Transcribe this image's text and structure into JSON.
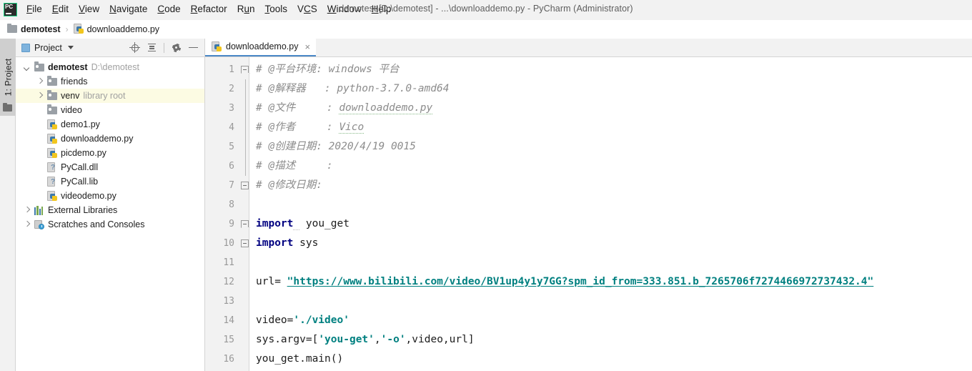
{
  "window": {
    "title": "demotest [D:\\demotest] - ...\\downloaddemo.py - PyCharm (Administrator)",
    "logo_text": "PC"
  },
  "menubar": {
    "items": [
      {
        "label": "File",
        "mnemonic": "F"
      },
      {
        "label": "Edit",
        "mnemonic": "E"
      },
      {
        "label": "View",
        "mnemonic": "V"
      },
      {
        "label": "Navigate",
        "mnemonic": "N"
      },
      {
        "label": "Code",
        "mnemonic": "C"
      },
      {
        "label": "Refactor",
        "mnemonic": "R"
      },
      {
        "label": "Run",
        "mnemonic": "u"
      },
      {
        "label": "Tools",
        "mnemonic": "T"
      },
      {
        "label": "VCS",
        "mnemonic": "C"
      },
      {
        "label": "Window",
        "mnemonic": "W"
      },
      {
        "label": "Help",
        "mnemonic": "H"
      }
    ]
  },
  "breadcrumb": {
    "project": "demotest",
    "separator": "›",
    "file": "downloaddemo.py"
  },
  "left_strip": {
    "tool_tab": "1: Project",
    "tool_tab_icon": "folder-icon"
  },
  "project_panel": {
    "title": "Project",
    "tools": [
      {
        "name": "locate-icon",
        "tooltip": "Select Opened File"
      },
      {
        "name": "collapse-all-icon",
        "tooltip": "Collapse All"
      },
      {
        "name": "gear-icon",
        "tooltip": "Settings"
      },
      {
        "name": "minimize-icon",
        "tooltip": "Hide"
      }
    ],
    "tree": [
      {
        "label": "demotest",
        "sub": "D:\\demotest",
        "icon": "folder-icon",
        "arrow": "down",
        "indent": 0,
        "bold": true,
        "highlight": false
      },
      {
        "label": "friends",
        "sub": "",
        "icon": "folder-icon",
        "arrow": "right",
        "indent": 1,
        "bold": false,
        "highlight": false
      },
      {
        "label": "venv",
        "sub": "library root",
        "icon": "folder-icon",
        "arrow": "right",
        "indent": 1,
        "bold": false,
        "highlight": true
      },
      {
        "label": "video",
        "sub": "",
        "icon": "folder-icon",
        "arrow": "none",
        "indent": 1,
        "bold": false,
        "highlight": false
      },
      {
        "label": "demo1.py",
        "sub": "",
        "icon": "python-file-icon",
        "arrow": "none",
        "indent": 1,
        "bold": false,
        "highlight": false
      },
      {
        "label": "downloaddemo.py",
        "sub": "",
        "icon": "python-file-icon",
        "arrow": "none",
        "indent": 1,
        "bold": false,
        "highlight": false
      },
      {
        "label": "picdemo.py",
        "sub": "",
        "icon": "python-file-icon",
        "arrow": "none",
        "indent": 1,
        "bold": false,
        "highlight": false
      },
      {
        "label": "PyCall.dll",
        "sub": "",
        "icon": "unknown-file-icon",
        "arrow": "none",
        "indent": 1,
        "bold": false,
        "highlight": false
      },
      {
        "label": "PyCall.lib",
        "sub": "",
        "icon": "unknown-file-icon",
        "arrow": "none",
        "indent": 1,
        "bold": false,
        "highlight": false
      },
      {
        "label": "videodemo.py",
        "sub": "",
        "icon": "python-file-icon",
        "arrow": "none",
        "indent": 1,
        "bold": false,
        "highlight": false
      },
      {
        "label": "External Libraries",
        "sub": "",
        "icon": "libraries-icon",
        "arrow": "right",
        "indent": 0,
        "bold": false,
        "highlight": false
      },
      {
        "label": "Scratches and Consoles",
        "sub": "",
        "icon": "scratches-icon",
        "arrow": "right",
        "indent": 0,
        "bold": false,
        "highlight": false
      }
    ]
  },
  "editor": {
    "tab": {
      "label": "downloaddemo.py",
      "icon": "python-file-icon",
      "close": "×"
    },
    "line_numbers": [
      "1",
      "2",
      "3",
      "4",
      "5",
      "6",
      "7",
      "8",
      "9",
      "10",
      "11",
      "12",
      "13",
      "14",
      "15",
      "16"
    ],
    "lines": [
      {
        "n": 1,
        "fold": "start",
        "segments": [
          {
            "t": "# @平台环境: windows 平台",
            "c": "cmt"
          }
        ]
      },
      {
        "n": 2,
        "fold": "body",
        "segments": [
          {
            "t": "# @解释器   : python-3.7.0-amd64",
            "c": "cmt"
          }
        ]
      },
      {
        "n": 3,
        "fold": "body",
        "segments": [
          {
            "t": "# @文件     : ",
            "c": "cmt"
          },
          {
            "t": "downloaddemo.py",
            "c": "cmt grn-under"
          }
        ]
      },
      {
        "n": 4,
        "fold": "body",
        "segments": [
          {
            "t": "# @作者     : ",
            "c": "cmt"
          },
          {
            "t": "Vico",
            "c": "cmt grn-under"
          }
        ]
      },
      {
        "n": 5,
        "fold": "body",
        "segments": [
          {
            "t": "# @创建日期: 2020/4/19 0015",
            "c": "cmt"
          }
        ]
      },
      {
        "n": 6,
        "fold": "body",
        "segments": [
          {
            "t": "# @描述     :",
            "c": "cmt"
          }
        ]
      },
      {
        "n": 7,
        "fold": "end",
        "segments": [
          {
            "t": "# @修改日期:",
            "c": "cmt"
          }
        ]
      },
      {
        "n": 8,
        "fold": "none",
        "segments": []
      },
      {
        "n": 9,
        "fold": "start2",
        "segments": [
          {
            "t": "import",
            "c": "kw"
          },
          {
            "t": " ",
            "c": "pln sq-under"
          },
          {
            "t": " you_get",
            "c": "pln"
          }
        ]
      },
      {
        "n": 10,
        "fold": "end2",
        "segments": [
          {
            "t": "import",
            "c": "kw"
          },
          {
            "t": " sys",
            "c": "pln"
          }
        ]
      },
      {
        "n": 11,
        "fold": "none",
        "segments": []
      },
      {
        "n": 12,
        "fold": "none",
        "segments": [
          {
            "t": "url= ",
            "c": "pln"
          },
          {
            "t": "\"https://www.bilibili.com/video/BV1up4y1y7GG?spm_id_from=333.851.b_7265706f7274466972737432.4\"",
            "c": "url-str"
          }
        ]
      },
      {
        "n": 13,
        "fold": "none",
        "segments": []
      },
      {
        "n": 14,
        "fold": "none",
        "segments": [
          {
            "t": "video=",
            "c": "pln"
          },
          {
            "t": "'./video'",
            "c": "str"
          }
        ]
      },
      {
        "n": 15,
        "fold": "none",
        "segments": [
          {
            "t": "sys.argv=[",
            "c": "pln"
          },
          {
            "t": "'you-get'",
            "c": "str"
          },
          {
            "t": ",",
            "c": "pln"
          },
          {
            "t": "'-o'",
            "c": "str"
          },
          {
            "t": ",video,url]",
            "c": "pln"
          }
        ]
      },
      {
        "n": 16,
        "fold": "none",
        "segments": [
          {
            "t": "you_get.main()",
            "c": "pln"
          }
        ]
      }
    ]
  },
  "colors": {
    "accent_tab": "#4a88c7",
    "string": "#008080",
    "keyword": "#000080",
    "comment": "#8c8c8c",
    "tree_highlight": "#fcfbe3",
    "chrome": "#f2f2f2",
    "logo_green": "#21d789"
  }
}
